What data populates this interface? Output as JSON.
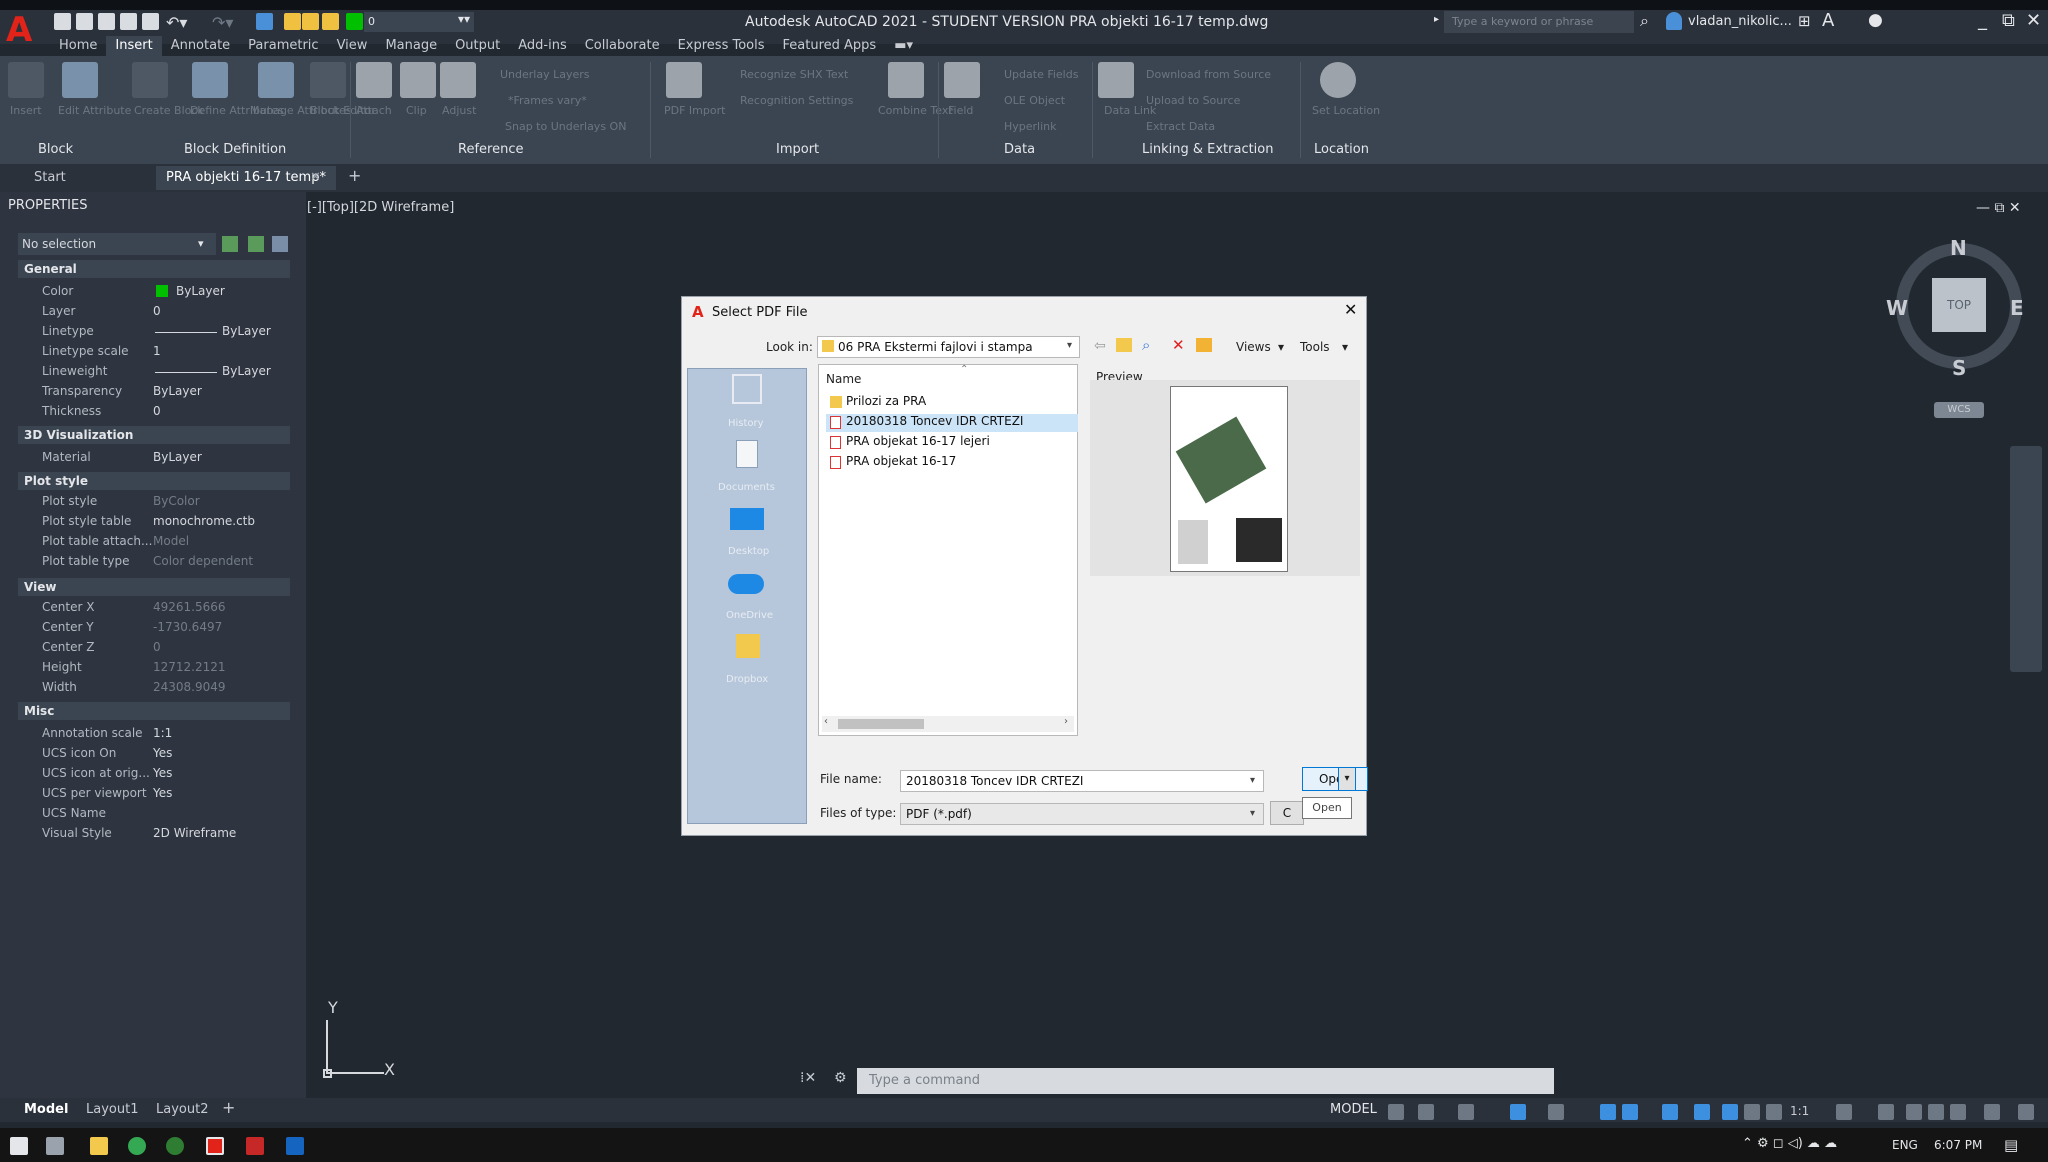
{
  "app": {
    "title": "Autodesk AutoCAD 2021 - STUDENT VERSION    PRA objekti 16-17 temp.dwg",
    "search_placeholder": "Type a keyword or phrase",
    "user": "vladan_nikolic...",
    "layer_combo": "0"
  },
  "menu_tabs": [
    "Home",
    "Insert",
    "Annotate",
    "Parametric",
    "View",
    "Manage",
    "Output",
    "Add-ins",
    "Collaborate",
    "Express Tools",
    "Featured Apps"
  ],
  "active_tab": "Insert",
  "ribbon": {
    "panels": [
      "Block",
      "Block Definition",
      "Reference",
      "Import",
      "Data",
      "Linking & Extraction",
      "Location"
    ],
    "buttons": [
      "Insert",
      "Edit Attribute",
      "Create Block",
      "Define Attributes",
      "Manage Attributes",
      "Block Editor",
      "Attach",
      "Clip",
      "Adjust",
      "PDF Import",
      "Combine Text",
      "Field",
      "Data Link",
      "Set Location"
    ],
    "small_items": [
      "Underlay Layers",
      "*Frames vary*",
      "Snap to Underlays ON",
      "Recognize SHX Text",
      "Recognition Settings",
      "Update Fields",
      "OLE Object",
      "Hyperlink",
      "Download from Source",
      "Upload to Source",
      "Extract Data"
    ]
  },
  "doc_tabs": {
    "start": "Start",
    "active": "PRA objekti 16-17 temp*"
  },
  "palette": {
    "title": "PROPERTIES",
    "selection": "No selection",
    "sections": [
      {
        "name": "General",
        "rows": [
          {
            "label": "Color",
            "value": "ByLayer"
          },
          {
            "label": "Layer",
            "value": "0"
          },
          {
            "label": "Linetype",
            "value": "ByLayer"
          },
          {
            "label": "Linetype scale",
            "value": "1"
          },
          {
            "label": "Lineweight",
            "value": "ByLayer"
          },
          {
            "label": "Transparency",
            "value": "ByLayer"
          },
          {
            "label": "Thickness",
            "value": "0"
          }
        ]
      },
      {
        "name": "3D Visualization",
        "rows": [
          {
            "label": "Material",
            "value": "ByLayer"
          }
        ]
      },
      {
        "name": "Plot style",
        "rows": [
          {
            "label": "Plot style",
            "value": "ByColor"
          },
          {
            "label": "Plot style table",
            "value": "monochrome.ctb"
          },
          {
            "label": "Plot table attach...",
            "value": "Model"
          },
          {
            "label": "Plot table type",
            "value": "Color dependent"
          }
        ]
      },
      {
        "name": "View",
        "rows": [
          {
            "label": "Center X",
            "value": "49261.5666"
          },
          {
            "label": "Center Y",
            "value": "-1730.6497"
          },
          {
            "label": "Center Z",
            "value": "0"
          },
          {
            "label": "Height",
            "value": "12712.2121"
          },
          {
            "label": "Width",
            "value": "24308.9049"
          }
        ]
      },
      {
        "name": "Misc",
        "rows": [
          {
            "label": "Annotation scale",
            "value": "1:1"
          },
          {
            "label": "UCS icon On",
            "value": "Yes"
          },
          {
            "label": "UCS icon at orig...",
            "value": "Yes"
          },
          {
            "label": "UCS per viewport",
            "value": "Yes"
          },
          {
            "label": "UCS Name",
            "value": ""
          },
          {
            "label": "Visual Style",
            "value": "2D Wireframe"
          }
        ]
      }
    ]
  },
  "viewport": {
    "label": "[-][Top][2D Wireframe]",
    "viewcube": {
      "top": "TOP",
      "n": "N",
      "s": "S",
      "e": "E",
      "w": "W",
      "wcs": "WCS"
    },
    "ucs": {
      "x": "X",
      "y": "Y"
    }
  },
  "dialog": {
    "title": "Select PDF File",
    "look_in_label": "Look in:",
    "look_in_value": "06 PRA Ekstermi fajlovi i stampa",
    "views": "Views",
    "tools": "Tools",
    "name_header": "Name",
    "preview_label": "Preview",
    "places": [
      "History",
      "Documents",
      "Desktop",
      "OneDrive",
      "Dropbox"
    ],
    "files": [
      {
        "name": "Prilozi za PRA",
        "type": "folder"
      },
      {
        "name": "20180318 Toncev IDR CRTEZI",
        "type": "pdf"
      },
      {
        "name": "PRA objekat 16-17 lejeri",
        "type": "pdf"
      },
      {
        "name": "PRA objekat 16-17",
        "type": "pdf"
      }
    ],
    "selected_file": "20180318 Toncev IDR CRTEZI",
    "file_name_label": "File name:",
    "file_name_value": "20180318 Toncev IDR CRTEZI",
    "file_type_label": "Files of type:",
    "file_type_value": "PDF (*.pdf)",
    "open_button": "Open",
    "cancel_button": "C",
    "tooltip": "Open"
  },
  "command": {
    "placeholder": "Type a command"
  },
  "layout_tabs": [
    "Model",
    "Layout1",
    "Layout2"
  ],
  "status": {
    "model": "MODEL",
    "scale": "1:1"
  },
  "taskbar": {
    "lang": "ENG",
    "time": "6:07 PM"
  },
  "colors": {
    "accent": "#0078d7",
    "autocad_red": "#e2231a",
    "bylayer_green": "#00c000"
  }
}
